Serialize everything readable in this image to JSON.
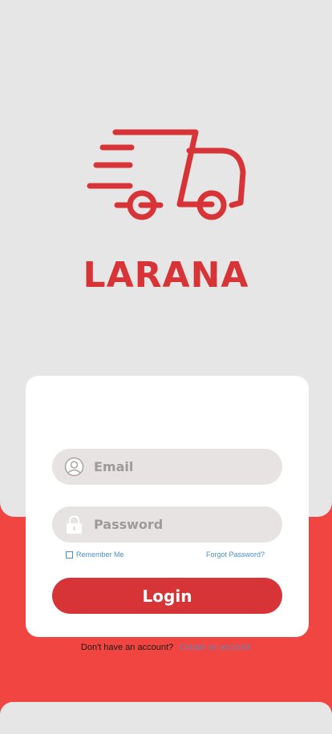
{
  "app": {
    "brand_name": "LARANA"
  },
  "login_form": {
    "email_placeholder": "Email",
    "password_placeholder": "Password",
    "remember_me_label": "Remember Me",
    "forgot_password_label": "Forgot Password?",
    "login_button_label": "Login"
  },
  "signup": {
    "question": "Don't have an account?",
    "link_label": "Create an account"
  },
  "icons": {
    "logo": "delivery-truck-icon",
    "email": "user-icon",
    "password": "lock-icon"
  },
  "colors": {
    "brand_red": "#d63437",
    "background_red": "#f04540",
    "panel_gray": "#e6e6e6",
    "link_blue": "#4a90c8"
  }
}
